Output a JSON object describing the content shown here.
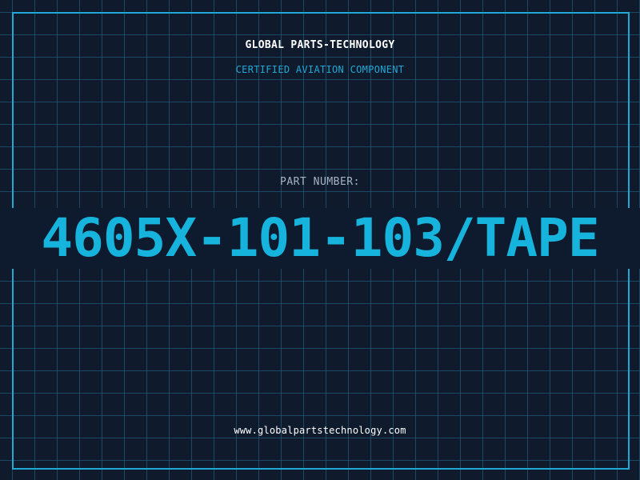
{
  "header": {
    "company": "GLOBAL PARTS-TECHNOLOGY",
    "tagline": "CERTIFIED AVIATION COMPONENT"
  },
  "part": {
    "label": "PART NUMBER:",
    "number": "4605X-101-103/TAPE"
  },
  "footer": {
    "website": "www.globalpartstechnology.com"
  },
  "colors": {
    "background": "#0f1b2d",
    "grid": "#286e8c",
    "accent": "#1fa8d6",
    "part_number": "#16b4dc",
    "label": "#a7b3c2",
    "text": "#ffffff"
  }
}
